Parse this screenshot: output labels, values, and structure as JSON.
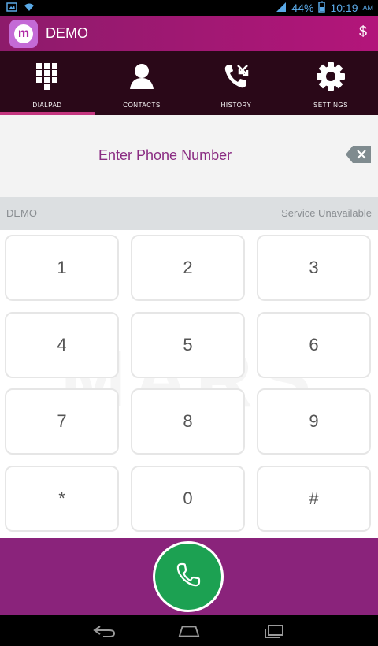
{
  "status_bar": {
    "battery": "44%",
    "time": "10:19",
    "ampm": "AM"
  },
  "app_bar": {
    "title": "DEMO",
    "logo_letter": "m",
    "credit_symbol": "$"
  },
  "tabs": [
    {
      "label": "DIALPAD",
      "icon": "dialpad-icon",
      "active": true
    },
    {
      "label": "CONTACTS",
      "icon": "contact-icon",
      "active": false
    },
    {
      "label": "HISTORY",
      "icon": "call-history-icon",
      "active": false
    },
    {
      "label": "SETTINGS",
      "icon": "gear-icon",
      "active": false
    }
  ],
  "number_field": {
    "placeholder": "Enter Phone Number"
  },
  "account_bar": {
    "account": "DEMO",
    "status": "Service Unavailable"
  },
  "keypad": {
    "watermark": "MARS",
    "keys": [
      "1",
      "2",
      "3",
      "4",
      "5",
      "6",
      "7",
      "8",
      "9",
      "*",
      "0",
      "#"
    ]
  },
  "colors": {
    "brand": "#8a237b",
    "tabs_bg": "#2a0818",
    "call_green": "#1ca152"
  }
}
